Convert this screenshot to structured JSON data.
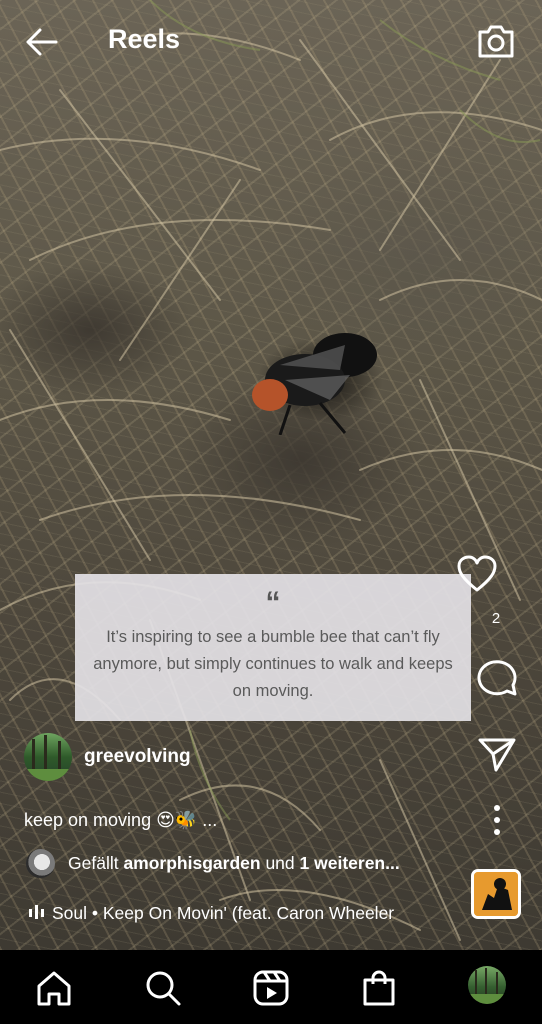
{
  "header": {
    "title": "Reels",
    "back_icon": "arrow-left-icon",
    "camera_icon": "camera-icon"
  },
  "reel": {
    "quote": {
      "mark": "“",
      "text": "It’s inspiring to see a bumble bee that can’t fly anymore, but simply continues to walk and keeps on moving."
    },
    "author": {
      "username": "greevolving"
    },
    "caption": "keep on moving 😍🐝 ...",
    "liked_by": {
      "prefix": "Gefällt ",
      "user": "amorphisgarden",
      "middle": " und ",
      "others": "1 weiteren..."
    },
    "audio": {
      "text": "Soul • Keep On Movin' (feat. Caron Wheeler",
      "icon": "audio-bars-icon"
    },
    "actions": {
      "like_count": "2",
      "like_icon": "heart-icon",
      "comment_icon": "comment-icon",
      "share_icon": "paper-plane-icon",
      "more_icon": "more-vertical-icon"
    }
  },
  "bottom_nav": {
    "items": [
      "home-icon",
      "search-icon",
      "reels-icon",
      "shop-icon",
      "profile-avatar"
    ]
  },
  "colors": {
    "card_background": "#e4e2e6",
    "card_text": "#5a5a5a",
    "nav_background": "#000000",
    "audio_thumb": "#e79a2e"
  }
}
